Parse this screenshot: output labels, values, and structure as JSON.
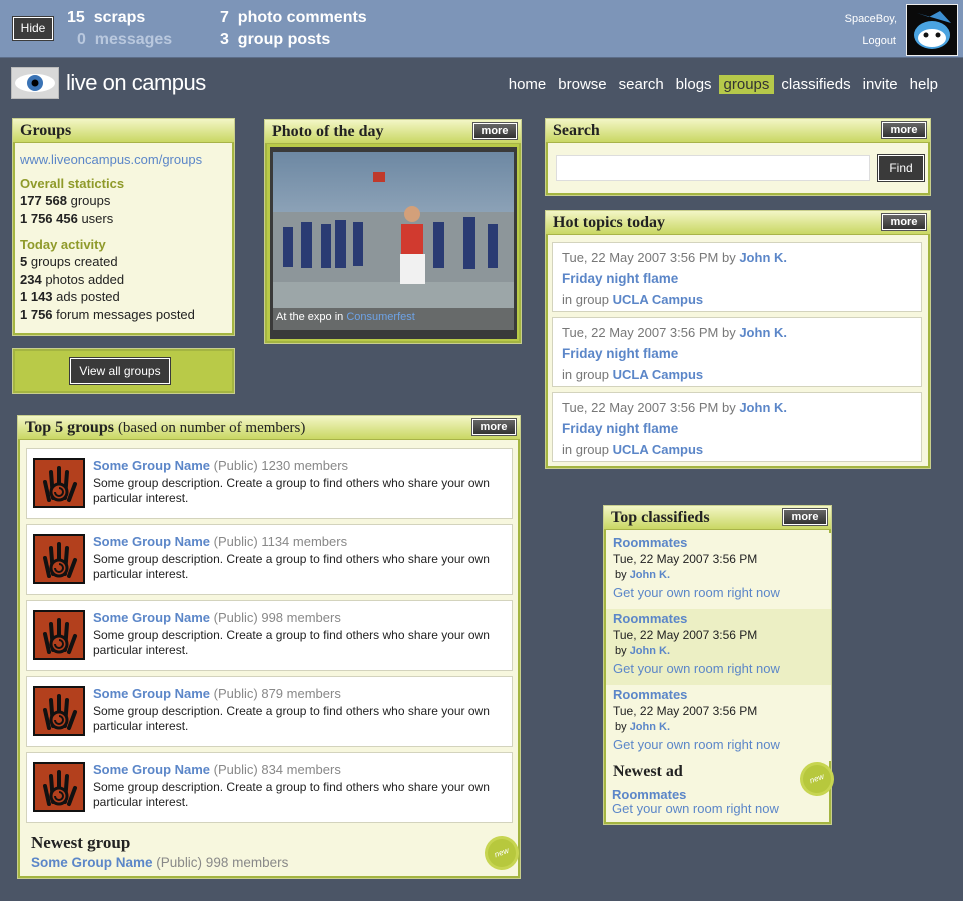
{
  "topbar": {
    "hide_label": "Hide",
    "scraps_count": "15",
    "scraps_label": "scraps",
    "messages_count": "0",
    "messages_label": "messages",
    "photo_comments_count": "7",
    "photo_comments_label": "photo comments",
    "group_posts_count": "3",
    "group_posts_label": "group posts",
    "username": "SpaceBoy,",
    "logout": "Logout"
  },
  "logo": {
    "text": "live on campus"
  },
  "nav": [
    {
      "label": "home"
    },
    {
      "label": "browse"
    },
    {
      "label": "search"
    },
    {
      "label": "blogs"
    },
    {
      "label": "groups",
      "active": true
    },
    {
      "label": "classifieds"
    },
    {
      "label": "invite"
    },
    {
      "label": "help"
    }
  ],
  "groups_panel": {
    "title": "Groups",
    "url": "www.liveoncampus.com/groups",
    "overall_title": "Overall statictics",
    "overall": [
      {
        "num": "177 568",
        "text": " groups"
      },
      {
        "num": "1 756 456",
        "text": " users"
      }
    ],
    "today_title": "Today activity",
    "today": [
      {
        "num": "5",
        "text": " groups created"
      },
      {
        "num": "234",
        "text": " photos added"
      },
      {
        "num": "1 143",
        "text": " ads posted"
      },
      {
        "num": "1 756",
        "text": " forum messages posted"
      }
    ],
    "view_all": "View all groups"
  },
  "photo_panel": {
    "title": "Photo of the day",
    "more": "more",
    "caption_prefix": "At the expo in ",
    "caption_link": "Consumerfest"
  },
  "search_panel": {
    "title": "Search",
    "more": "more",
    "placeholder": "",
    "find": "Find"
  },
  "hot_topics": {
    "title": "Hot topics today",
    "more": "more",
    "items": [
      {
        "date": "Tue, 22 May 2007 3:56 PM",
        "by": "by",
        "author": "John K.",
        "title": "Friday night flame",
        "in_group": "in group",
        "group": "UCLA Campus"
      },
      {
        "date": "Tue, 22 May 2007 3:56 PM",
        "by": "by",
        "author": "John K.",
        "title": "Friday night flame",
        "in_group": "in group",
        "group": "UCLA Campus"
      },
      {
        "date": "Tue, 22 May 2007 3:56 PM",
        "by": "by",
        "author": "John K.",
        "title": "Friday night flame",
        "in_group": "in group",
        "group": "UCLA Campus"
      }
    ]
  },
  "top_groups": {
    "title": "Top 5 groups",
    "subtitle": "(based on number of members)",
    "more": "more",
    "items": [
      {
        "name": "Some Group Name",
        "meta": "(Public) 1230 members",
        "desc": "Some group description. Create a group to find others who share your own particular interest."
      },
      {
        "name": "Some Group Name",
        "meta": "(Public) 1134 members",
        "desc": "Some group description. Create a group to find others who share your own particular interest."
      },
      {
        "name": "Some Group Name",
        "meta": "(Public) 998 members",
        "desc": "Some group description. Create a group to find others who share your own particular interest."
      },
      {
        "name": "Some Group Name",
        "meta": "(Public) 879 members",
        "desc": "Some group description. Create a group to find others who share your own particular interest."
      },
      {
        "name": "Some Group Name",
        "meta": "(Public) 834 members",
        "desc": "Some group description. Create a group to find others who share your own particular interest."
      }
    ],
    "newest_title": "Newest group",
    "newest_name": "Some Group Name",
    "newest_meta": "(Public) 998 members",
    "new_badge": "new"
  },
  "classifieds": {
    "title": "Top classifieds",
    "more": "more",
    "items": [
      {
        "title": "Roommates",
        "date": "Tue, 22 May 2007 3:56 PM",
        "by": "by",
        "author": "John K.",
        "link": "Get your own room right now"
      },
      {
        "title": "Roommates",
        "date": "Tue, 22 May 2007 3:56 PM",
        "by": "by",
        "author": "John K.",
        "link": "Get your own room right now"
      },
      {
        "title": "Roommates",
        "date": "Tue, 22 May 2007 3:56 PM",
        "by": "by",
        "author": "John K.",
        "link": "Get your own room right now"
      }
    ],
    "newest_title": "Newest ad",
    "newest_name": "Roommates",
    "newest_link": "Get your own room right now",
    "new_badge": "new"
  }
}
